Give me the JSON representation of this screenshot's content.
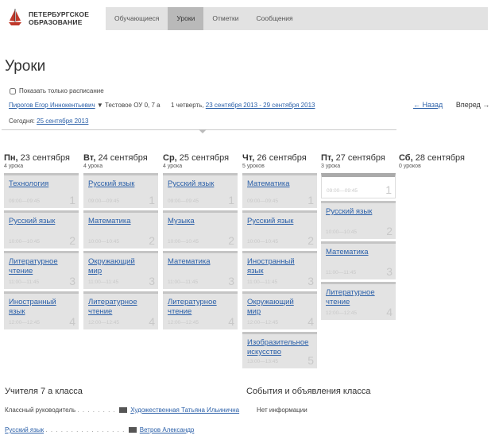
{
  "logo": {
    "line1": "ПЕТЕРБУРГСКОЕ",
    "line2": "ОБРАЗОВАНИЕ",
    "icon": "ship-icon",
    "color": "#c0392b"
  },
  "nav": {
    "items": [
      {
        "label": "Обучающиеся",
        "active": false
      },
      {
        "label": "Уроки",
        "active": true
      },
      {
        "label": "Отметки",
        "active": false
      },
      {
        "label": "Сообщения",
        "active": false
      }
    ]
  },
  "page_title": "Уроки",
  "schedule_only_label": "Показать только расписание",
  "filter": {
    "student": "Пирогов Егор Иннокентьевич",
    "school": "Тестовое ОУ 0, 7 а",
    "quarter": "1 четверть,",
    "period": "23 сентября 2013 - 29 сентября 2013",
    "today_label": "Сегодня:",
    "today": "25 сентября 2013"
  },
  "pager": {
    "prev": "← Назад",
    "next": "Вперед →"
  },
  "days": [
    {
      "abbr": "Пн,",
      "date": "23 сентября",
      "count": "4 урока",
      "lessons": [
        {
          "name": "Технология",
          "time": "09:00—09:45",
          "num": "1"
        },
        {
          "name": "Русский язык",
          "time": "10:00—10:45",
          "num": "2"
        },
        {
          "name": "Литературное чтение",
          "time": "11:00—11:45",
          "num": "3"
        },
        {
          "name": "Иностранный язык",
          "time": "12:00—12:45",
          "num": "4"
        }
      ]
    },
    {
      "abbr": "Вт,",
      "date": "24 сентября",
      "count": "4 урока",
      "lessons": [
        {
          "name": "Русский язык",
          "time": "09:00—09:45",
          "num": "1"
        },
        {
          "name": "Математика",
          "time": "10:00—10:45",
          "num": "2"
        },
        {
          "name": "Окружающий мир",
          "time": "11:00—11:45",
          "num": "3"
        },
        {
          "name": "Литературное чтение",
          "time": "12:00—12:45",
          "num": "4"
        }
      ]
    },
    {
      "abbr": "Ср,",
      "date": "25 сентября",
      "count": "4 урока",
      "lessons": [
        {
          "name": "Русский язык",
          "time": "09:00—09:45",
          "num": "1"
        },
        {
          "name": "Музыка",
          "time": "10:00—10:45",
          "num": "2"
        },
        {
          "name": "Математика",
          "time": "11:00—11:45",
          "num": "3"
        },
        {
          "name": "Литературное чтение",
          "time": "12:00—12:45",
          "num": "4"
        }
      ]
    },
    {
      "abbr": "Чт,",
      "date": "26 сентября",
      "count": "5 уроков",
      "lessons": [
        {
          "name": "Математика",
          "time": "09:00—09:45",
          "num": "1"
        },
        {
          "name": "Русский язык",
          "time": "10:00—10:45",
          "num": "2"
        },
        {
          "name": "Иностранный язык",
          "time": "11:00—11:45",
          "num": "3"
        },
        {
          "name": "Окружающий мир",
          "time": "12:00—12:45",
          "num": "4"
        },
        {
          "name": "Изобразительное искусство",
          "time": "13:00—13:45",
          "num": "5"
        }
      ]
    },
    {
      "abbr": "Пт,",
      "date": "27 сентября",
      "count": "3 урока",
      "lessons": [
        {
          "name": "",
          "time": "09:00—09:45",
          "num": "1"
        },
        {
          "name": "Русский язык",
          "time": "10:00—10:45",
          "num": "2"
        },
        {
          "name": "Математика",
          "time": "11:00—11:45",
          "num": "3"
        },
        {
          "name": "Литературное чтение",
          "time": "12:00—12:45",
          "num": "4"
        }
      ]
    },
    {
      "abbr": "Сб,",
      "date": "28 сентября",
      "count": "0 уроков",
      "lessons": []
    }
  ],
  "teachers": {
    "title": "Учителя 7 а класса",
    "rows": [
      {
        "role": "Классный руководитель",
        "name": "Художественная Татьяна Ильинична"
      },
      {
        "role": "Русский язык",
        "name": "Ветров Александр"
      }
    ]
  },
  "events": {
    "title": "События и объявления класса",
    "empty": "Нет информации"
  }
}
